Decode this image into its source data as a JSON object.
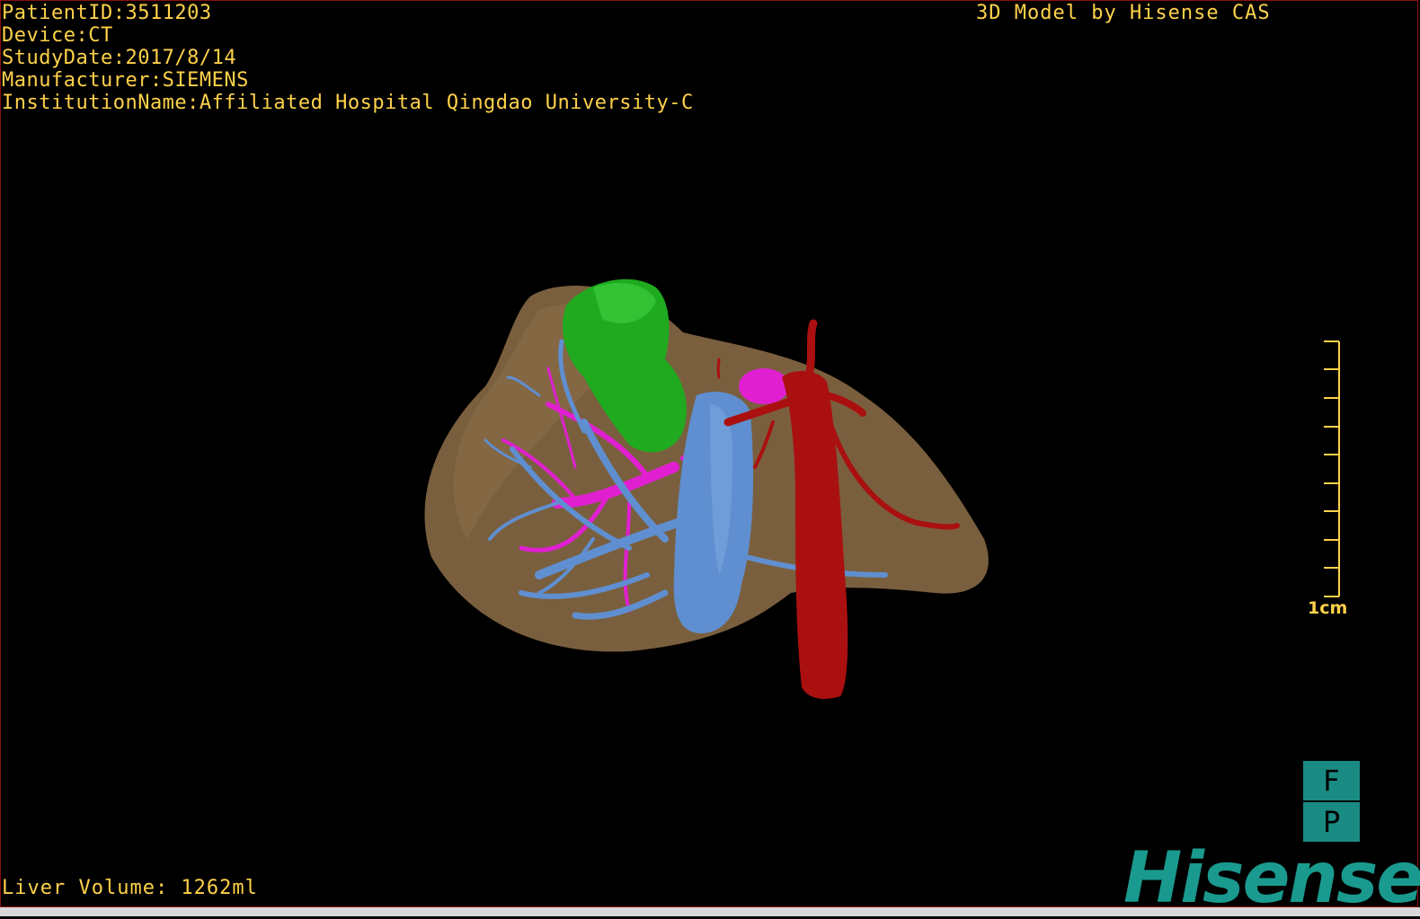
{
  "header": {
    "patient_id": "PatientID:3511203",
    "device": "Device:CT",
    "study_date": "StudyDate:2017/8/14",
    "manufacturer": "Manufacturer:SIEMENS",
    "institution": "InstitutionName:Affiliated Hospital Qingdao University-C"
  },
  "brand_text": "3D Model by Hisense CAS",
  "footer": {
    "liver_volume": "Liver Volume: 1262ml"
  },
  "scale_bar": {
    "label": "1cm"
  },
  "orientation": {
    "top": "F",
    "bottom": "P"
  },
  "logo": {
    "text": "Hisense"
  },
  "colors": {
    "text": "#ffd24a",
    "liver": "#7a5f3e",
    "tumor": "#1faa1f",
    "portal_vein": "#5f8fd0",
    "hepatic_vein": "#e020d0",
    "artery": "#aa1010",
    "brand": "#1a9a8e"
  }
}
